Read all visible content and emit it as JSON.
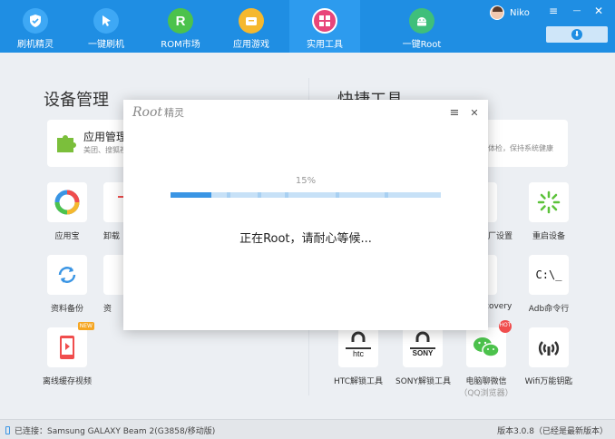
{
  "nav": [
    {
      "label": "刷机精灵",
      "icon": "shield-icon"
    },
    {
      "label": "一键刷机",
      "icon": "cursor-icon"
    },
    {
      "label": "ROM市场",
      "icon": "rom-icon"
    },
    {
      "label": "应用游戏",
      "icon": "apps-icon"
    },
    {
      "label": "实用工具",
      "icon": "toolbox-icon"
    },
    {
      "label": "一键Root",
      "icon": "android-icon"
    }
  ],
  "header": {
    "user_name": "Niko",
    "menu_glyph": "≡",
    "minimize_glyph": "—",
    "close_glyph": "✕",
    "download_glyph": "⬇"
  },
  "left_section": {
    "title": "设备管理",
    "app_card": {
      "title": "应用管理",
      "subtitle": "美团、搜狐视"
    },
    "tools": [
      {
        "label": "应用宝",
        "icon": "app-store-icon"
      },
      {
        "label": "卸载",
        "icon": "uninstall-icon"
      },
      {
        "label": "资料备份",
        "icon": "backup-icon"
      },
      {
        "label": "资",
        "icon": "restore-icon"
      },
      {
        "label": "离线缓存视频",
        "icon": "video-icon",
        "badge": "NEW"
      }
    ]
  },
  "right_section": {
    "title": "快捷工具",
    "card_subtitle": "体检，保持系统健康",
    "tools": [
      {
        "label": "厂设置",
        "icon": "gear-icon"
      },
      {
        "label": "重启设备",
        "icon": "restart-icon"
      },
      {
        "label": "covery",
        "icon": "recovery-icon"
      },
      {
        "label": "Adb命令行",
        "icon": "terminal-icon",
        "glyph": "C:\\_"
      },
      {
        "label": "HTC解锁工具",
        "icon": "htc-lock-icon",
        "glyph": "htc"
      },
      {
        "label": "SONY解锁工具",
        "icon": "sony-lock-icon",
        "glyph": "SONY"
      },
      {
        "label": "电脑聊微信",
        "sublabel": "（QQ浏览器）",
        "icon": "wechat-icon",
        "badge": "HOT"
      },
      {
        "label": "Wifi万能钥匙",
        "icon": "wifi-key-icon"
      }
    ]
  },
  "status": {
    "connection": "已连接：Samsung GALAXY Beam 2(G3858/移动版)",
    "version": "版本3.0.8（已经是最新版本）"
  },
  "modal": {
    "title_en": "Root",
    "title_cn": "精灵",
    "menu_glyph": "≡",
    "close_glyph": "✕",
    "progress_text": "15%",
    "progress": 0.15,
    "message": "正在Root，请耐心等候..."
  },
  "colors": {
    "header_bg": "#1f8ee3",
    "progress_fill": "#3a95e4",
    "progress_track": "#c7e1f7"
  }
}
